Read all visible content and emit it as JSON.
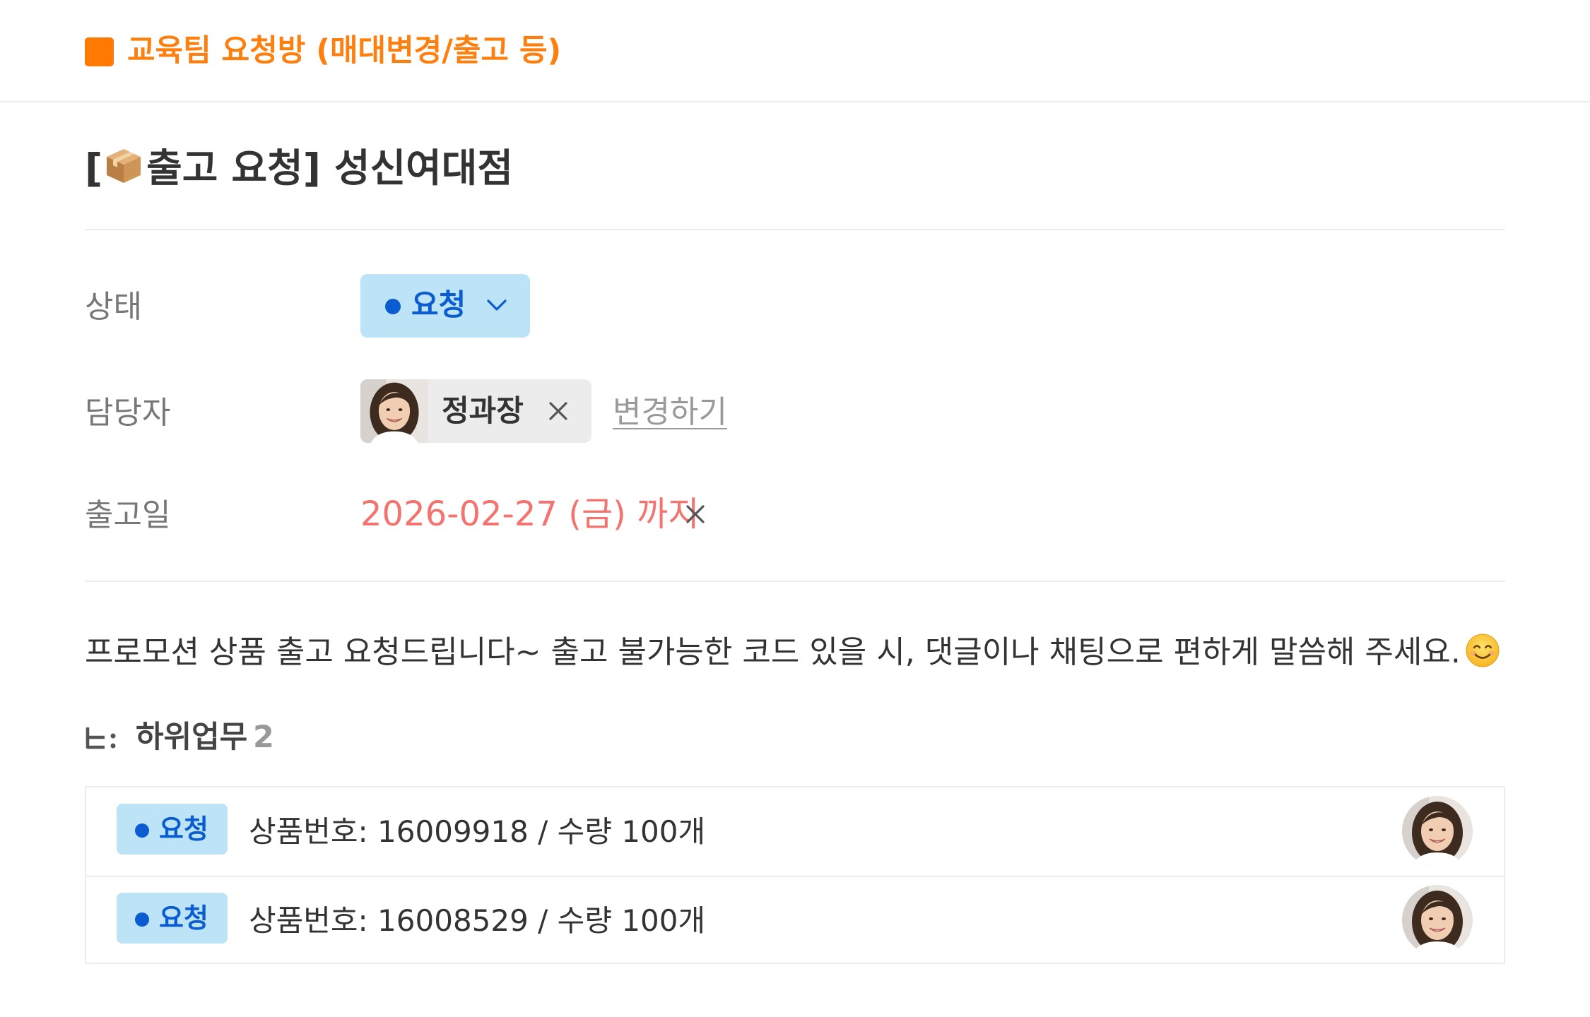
{
  "project": {
    "title": "교육팀 요청방 (매대변경/출고 등)",
    "color": "#ff7a00"
  },
  "task": {
    "title_prefix": "[",
    "title_icon": "package-icon",
    "title_text": "출고 요청] 성신여대점"
  },
  "properties": {
    "status": {
      "label": "상태",
      "value": "요청",
      "color": "#0a5cd0",
      "bg": "#bde3f7"
    },
    "assignee": {
      "label": "담당자",
      "name": "정과장",
      "change_link": "변경하기"
    },
    "due": {
      "label": "출고일",
      "value": "2026-02-27 (금) 까지",
      "color": "#f4736e"
    }
  },
  "description": "프로모션 상품 출고 요청드립니다~ 출고 불가능한 코드 있을 시, 댓글이나 채팅으로 편하게 말씀해 주세요.",
  "subtasks": {
    "label": "하위업무",
    "count": "2",
    "items": [
      {
        "status": "요청",
        "text": "상품번호: 16009918 / 수량 100개"
      },
      {
        "status": "요청",
        "text": "상품번호: 16008529 / 수량 100개"
      }
    ]
  }
}
